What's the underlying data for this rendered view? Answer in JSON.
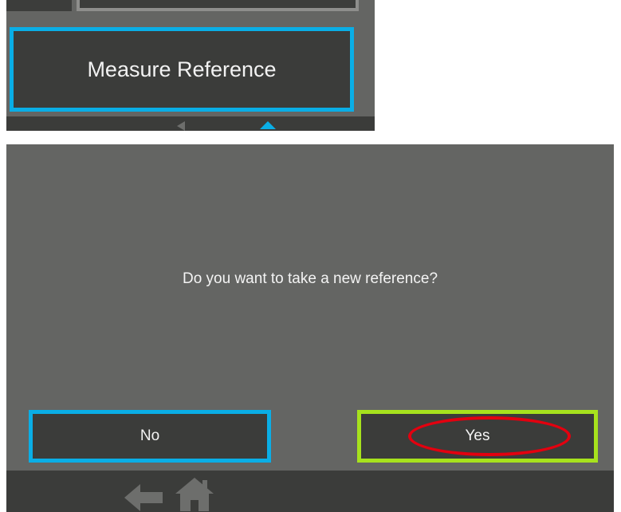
{
  "top_panel": {
    "measure_reference_label": "Measure Reference"
  },
  "dialog": {
    "prompt": "Do you want to take a new reference?",
    "no_label": "No",
    "yes_label": "Yes"
  },
  "nav": {
    "back_icon": "arrow-left-icon",
    "home_icon": "home-icon"
  },
  "colors": {
    "background": "#646563",
    "button": "#3b3c3a",
    "blue_outline": "#0aaee6",
    "green_outline": "#a7e21d",
    "red_annotation": "#e3000f",
    "text": "#f4f4f4"
  }
}
